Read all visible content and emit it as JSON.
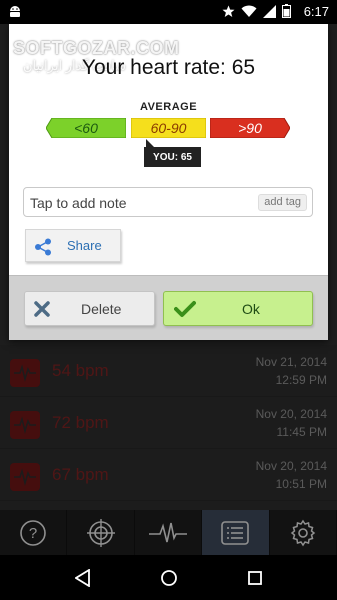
{
  "status_bar": {
    "time": "6:17"
  },
  "watermark": {
    "line1": "SOFTGOZAR.COM",
    "line2": "سافت گذار ایرانیان"
  },
  "dialog": {
    "title": "Your heart rate: 65",
    "average_label": "AVERAGE",
    "ranges": [
      "<60",
      "60-90",
      ">90"
    ],
    "you_badge": "YOU: 65",
    "note_placeholder": "Tap to add note",
    "add_tag_label": "add tag",
    "share_label": "Share",
    "delete_label": "Delete",
    "ok_label": "Ok"
  },
  "history": [
    {
      "bpm": "54 bpm",
      "date": "Nov 21, 2014",
      "time": "12:59 PM"
    },
    {
      "bpm": "72 bpm",
      "date": "Nov 20, 2014",
      "time": "11:45 PM"
    },
    {
      "bpm": "67 bpm",
      "date": "Nov 20, 2014",
      "time": "10:51 PM"
    }
  ],
  "tabs": [
    {
      "icon": "help-icon"
    },
    {
      "icon": "target-icon"
    },
    {
      "icon": "pulse-icon"
    },
    {
      "icon": "list-icon",
      "active": true
    },
    {
      "icon": "gear-icon"
    }
  ],
  "colors": {
    "range_low": "#7cd12a",
    "range_mid": "#f5df1c",
    "range_high": "#d92f1f",
    "ok_button": "#c7f08e"
  }
}
